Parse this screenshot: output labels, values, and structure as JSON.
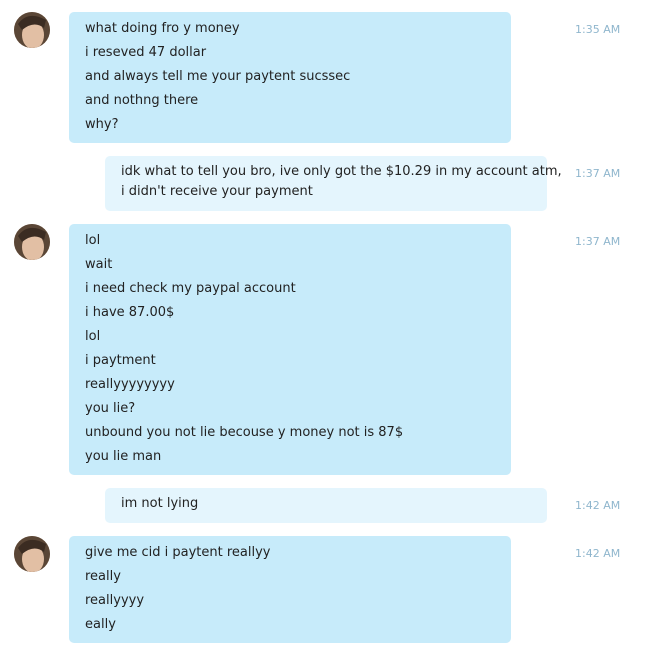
{
  "messages": [
    {
      "time": "1:35 AM",
      "lines": [
        "what  doing fro y money",
        "i reseved 47 dollar",
        "and always tell me your paytent sucssec",
        "and nothng there",
        "why?"
      ]
    },
    {
      "time": "1:37 AM",
      "lines": [
        "idk what to tell you bro, ive only got the $10.29 in my account atm,",
        "i didn't receive your payment"
      ]
    },
    {
      "time": "1:37 AM",
      "lines": [
        "lol",
        "wait",
        "i need check my paypal account",
        "i have 87.00$",
        "lol",
        "i paytment",
        "reallyyyyyyyy",
        "you lie?",
        "unbound you not lie becouse y money not is 87$",
        "you lie man"
      ]
    },
    {
      "time": "1:42 AM",
      "lines": [
        "im not lying"
      ]
    },
    {
      "time": "1:42 AM",
      "lines": [
        "give me cid i paytent reallyy",
        "really",
        "reallyyyy",
        "eally"
      ]
    }
  ],
  "colors": {
    "incoming_bubble": "#c7ebfa",
    "outgoing_bubble": "#e4f5fd",
    "timestamp": "#8fb6cd"
  },
  "icons": {
    "avatar": "contact-avatar-icon"
  }
}
